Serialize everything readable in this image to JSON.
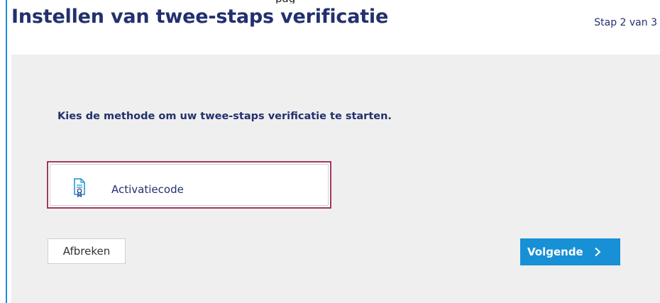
{
  "header": {
    "title": "Instellen van twee-staps verificatie",
    "step": "Stap 2 van 3",
    "top_clipped_text": "pag"
  },
  "main": {
    "instruction": "Kies de methode om uw twee-staps verificatie te starten.",
    "options": [
      {
        "label": "Activatiecode",
        "icon": "certificate-document-icon",
        "selected": true
      }
    ]
  },
  "buttons": {
    "cancel": "Afbreken",
    "next": "Volgende"
  },
  "colors": {
    "title": "#23306e",
    "accent": "#1790d6",
    "selected_border": "#9c3a64",
    "panel_bg": "#efefef"
  }
}
